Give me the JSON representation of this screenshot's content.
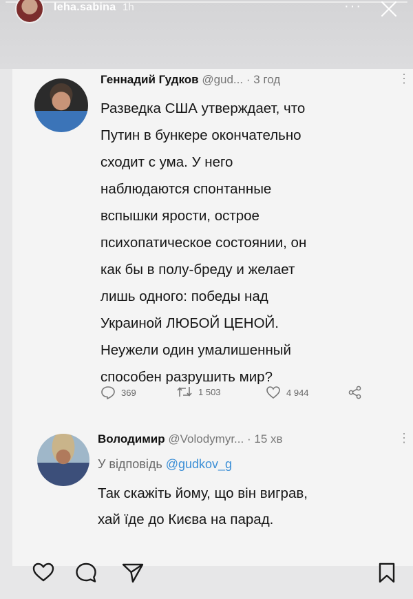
{
  "story": {
    "username": "leha.sabina",
    "time": "1h",
    "more": "···"
  },
  "tweet": {
    "author": "Геннадий Гудков",
    "handle": "@gud...",
    "separator": "·",
    "time": "3 год",
    "text": "Разведка США утверждает, что\nПутин в бункере окончательно\nсходит с ума. У него\nнаблюдаются спонтанные\nвспышки ярости, острое\nпсихопатическое состоянии, он\nкак бы в полу-бреду и желает\nлишь одного: победы над\nУкраиной ЛЮБОЙ ЦЕНОЙ.\nНеужели один умалишенный\nспособен разрушить мир?",
    "replies": "369",
    "retweets": "1 503",
    "likes": "4 944"
  },
  "reply": {
    "author": "Володимир",
    "handle": "@Volodymyr...",
    "separator": "·",
    "time": "15 хв",
    "reply_prefix": "У відповідь",
    "reply_mention": "@gudkov_g",
    "text": "Так скажіть йому, що він виграв,\nхай їде до Києва на парад."
  },
  "icons": {
    "reply": "comment-icon",
    "retweet": "retweet-icon",
    "like": "heart-icon",
    "share": "share-icon",
    "story_like": "heart-outline-icon",
    "story_comment": "chat-bubble-icon",
    "story_send": "send-icon",
    "story_save": "bookmark-icon",
    "close": "close-icon"
  }
}
